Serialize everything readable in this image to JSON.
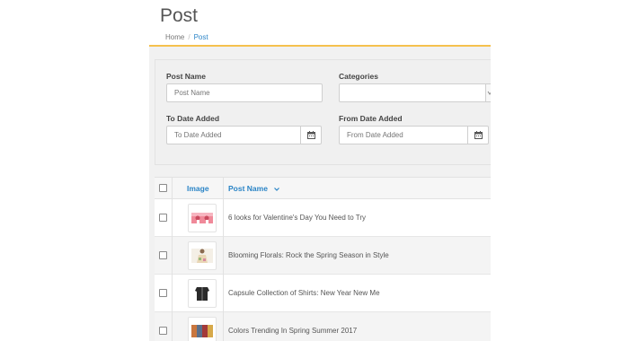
{
  "page": {
    "title": "Post",
    "breadcrumb": {
      "home": "Home",
      "separator": "/",
      "current": "Post"
    }
  },
  "filters": {
    "post_name": {
      "label": "Post Name",
      "placeholder": "Post Name",
      "value": ""
    },
    "categories": {
      "label": "Categories",
      "value": ""
    },
    "to_date": {
      "label": "To Date Added",
      "placeholder": "To Date Added",
      "value": ""
    },
    "from_date": {
      "label": "From Date Added",
      "placeholder": "From Date Added",
      "value": ""
    }
  },
  "table": {
    "columns": {
      "image": "Image",
      "post_name": "Post Name"
    },
    "sort_indicator": "chevron-down-icon",
    "rows": [
      {
        "name": "6 looks for Valentine's Day You Need to Try",
        "thumb": "valentine-fashion-thumbnail"
      },
      {
        "name": "Blooming Florals: Rock the Spring Season in Style",
        "thumb": "florals-fashion-thumbnail"
      },
      {
        "name": "Capsule Collection of Shirts: New Year New Me",
        "thumb": "shirts-collection-thumbnail"
      },
      {
        "name": "Colors Trending In Spring Summer 2017",
        "thumb": "colors-trending-thumbnail"
      }
    ]
  },
  "colors": {
    "accent": "#2a84c6",
    "header_border": "#f5c14d"
  }
}
